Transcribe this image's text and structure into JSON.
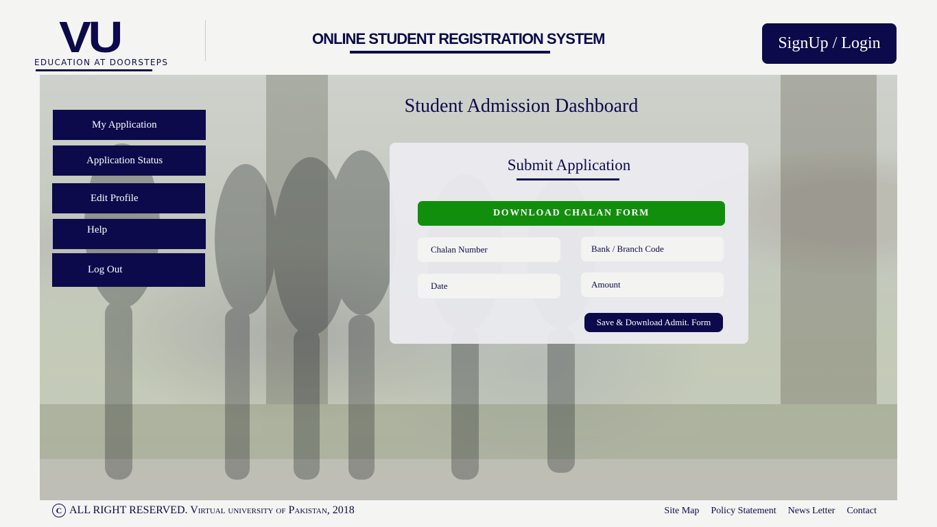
{
  "header": {
    "logo_mark": "VU",
    "logo_tagline": "EDUCATION AT DOORSTEPS",
    "system_title": "ONLINE STUDENT REGISTRATION SYSTEM",
    "signup_login_label": "SignUp / Login"
  },
  "page": {
    "heading": "Student Admission Dashboard"
  },
  "sidebar": {
    "items": [
      {
        "label": "My Application"
      },
      {
        "label": "Application Status"
      },
      {
        "label": "Edit Profile"
      },
      {
        "label": "Help"
      },
      {
        "label": "Log Out"
      }
    ]
  },
  "panel": {
    "title": "Submit Application",
    "download_label": "DOWNLOAD CHALAN FORM",
    "fields": {
      "chalan_number": {
        "placeholder": "Chalan Number",
        "value": ""
      },
      "bank_branch_code": {
        "placeholder": "Bank / Branch Code",
        "value": ""
      },
      "date": {
        "placeholder": "Date",
        "value": ""
      },
      "amount": {
        "placeholder": "Amount",
        "value": ""
      }
    },
    "save_label": "Save & Download Admit. Form"
  },
  "footer": {
    "copyright_symbol": "C",
    "copyright_text": "ALL RIGHT RESERVED. Virtual university of Pakistan, 2018",
    "links": [
      {
        "label": "Site Map"
      },
      {
        "label": "Policy Statement"
      },
      {
        "label": "News Letter"
      },
      {
        "label": "Contact"
      }
    ]
  },
  "colors": {
    "navy": "#0c0a4a",
    "green": "#128e0d",
    "background": "#f4f4f2",
    "panel": "#ebebf0"
  },
  "icons": {
    "copyright": "copyright-icon"
  }
}
